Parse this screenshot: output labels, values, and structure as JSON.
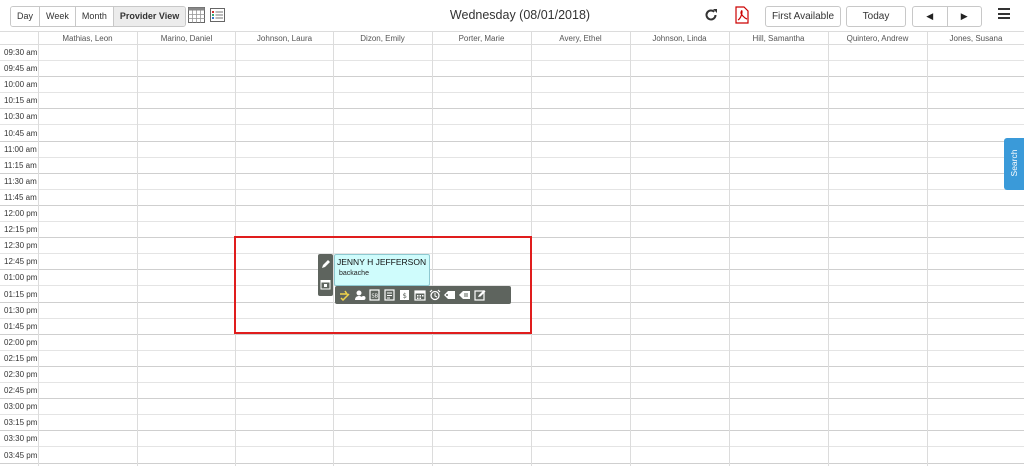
{
  "toolbar": {
    "views": [
      "Day",
      "Week",
      "Month",
      "Provider View"
    ],
    "active_view": "Provider View",
    "date_title": "Wednesday (08/01/2018)",
    "first_available_label": "First Available",
    "today_label": "Today",
    "prev_label": "◀",
    "next_label": "▶"
  },
  "providers": [
    "Mathias, Leon",
    "Marino, Daniel",
    "Johnson, Laura",
    "Dizon, Emily",
    "Porter, Marie",
    "Avery, Ethel",
    "Johnson, Linda",
    "Hill, Samantha",
    "Quintero, Andrew",
    "Jones, Susana"
  ],
  "times": [
    "09:30 am",
    "09:45 am",
    "10:00 am",
    "10:15 am",
    "10:30 am",
    "10:45 am",
    "11:00 am",
    "11:15 am",
    "11:30 am",
    "11:45 am",
    "12:00 pm",
    "12:15 pm",
    "12:30 pm",
    "12:45 pm",
    "01:00 pm",
    "01:15 pm",
    "01:30 pm",
    "01:45 pm",
    "02:00 pm",
    "02:15 pm",
    "02:30 pm",
    "02:45 pm",
    "03:00 pm",
    "03:15 pm",
    "03:30 pm",
    "03:45 pm"
  ],
  "appointment": {
    "patient_name": "JENNY H JEFFERSON",
    "reason": "backache"
  },
  "search_tab_label": "Search",
  "colors": {
    "highlight": "#e01d1d",
    "appointment_bg": "#cffcfc",
    "search_tab": "#3a9ad9",
    "toolbar_dark": "#5e645e"
  }
}
